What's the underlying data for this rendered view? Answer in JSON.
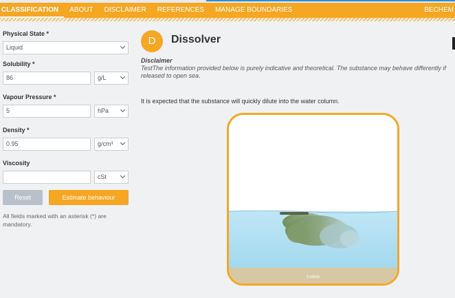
{
  "nav": {
    "items": [
      "CLASSIFICATION",
      "ABOUT",
      "DISCLAIMER",
      "REFERENCES",
      "MANAGE BOUNDARIES"
    ],
    "right": "BECHEM"
  },
  "form": {
    "physical_state": {
      "label": "Physical State *",
      "value": "Liquid"
    },
    "solubility": {
      "label": "Solubility *",
      "value": "86",
      "unit": "g/L"
    },
    "vapour_pressure": {
      "label": "Vapour Pressure *",
      "value": "5",
      "unit": "hPa"
    },
    "density": {
      "label": "Density *",
      "value": "0.95",
      "unit": "g/cm³"
    },
    "viscosity": {
      "label": "Viscosity",
      "value": "",
      "unit": "cSt"
    },
    "reset": "Reset",
    "estimate": "Estimate behaviour",
    "note": "All fields marked with an asterisk (*) are mandatory."
  },
  "result": {
    "badge": "D",
    "title": "Dissolver",
    "disclaimer_title": "Disclaimer",
    "disclaimer_text": "TestThe information provided below is purely indicative and theoretical. The substance may behave differently if released to open sea.",
    "expected": "It is expected that the substance will quickly dilute into the water column.",
    "credit": "© EMSA"
  },
  "colors": {
    "accent": "#f5a623",
    "sky": "#ffffff",
    "water": "#a9dcef",
    "seabed": "#d6c8a4",
    "plume": "#7f9a62"
  }
}
